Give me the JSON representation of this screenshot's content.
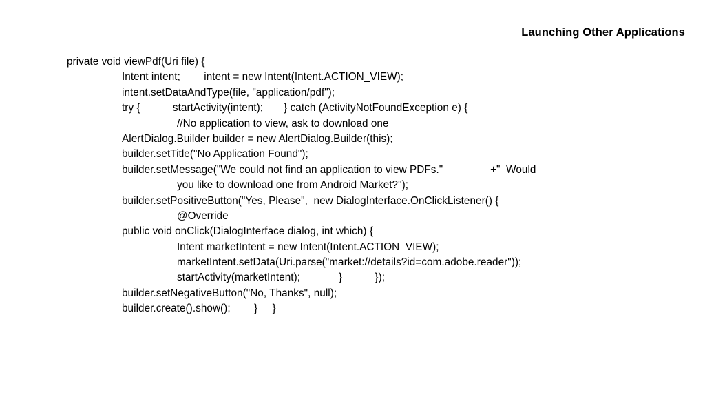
{
  "slide": {
    "title": "Launching Other Applications",
    "background_color": "#ffffff",
    "text_color": "#000000",
    "code_lines": [
      {
        "indent": 0,
        "text": "private void viewPdf(Uri file) {"
      },
      {
        "indent": 1,
        "text": "Intent intent;        intent = new Intent(Intent.ACTION_VIEW);"
      },
      {
        "indent": 1,
        "text": "intent.setDataAndType(file, \"application/pdf\");"
      },
      {
        "indent": 1,
        "text": "try {           startActivity(intent);       } catch (ActivityNotFoundException e) {"
      },
      {
        "indent": 2,
        "text": "//No application to view, ask to download one"
      },
      {
        "indent": 1,
        "text": "AlertDialog.Builder builder = new AlertDialog.Builder(this);"
      },
      {
        "indent": 1,
        "text": "builder.setTitle(\"No Application Found\");"
      },
      {
        "indent": 1,
        "text": "builder.setMessage(\"We could not find an application to view PDFs.\"                +\"  Would"
      },
      {
        "indent": 2,
        "text": "you like to download one from Android Market?\");"
      },
      {
        "indent": 1,
        "text": "builder.setPositiveButton(\"Yes, Please\",  new DialogInterface.OnClickListener() {"
      },
      {
        "indent": 2,
        "text": "@Override"
      },
      {
        "indent": 1,
        "text": "public void onClick(DialogInterface dialog, int which) {"
      },
      {
        "indent": 2,
        "text": "Intent marketIntent = new Intent(Intent.ACTION_VIEW);"
      },
      {
        "indent": 2,
        "text": "marketIntent.setData(Uri.parse(\"market://details?id=com.adobe.reader\"));"
      },
      {
        "indent": 2,
        "text": "startActivity(marketIntent);             }           });"
      },
      {
        "indent": 1,
        "text": "builder.setNegativeButton(\"No, Thanks\", null);"
      },
      {
        "indent": 1,
        "text": "builder.create().show();        }     }"
      }
    ]
  }
}
